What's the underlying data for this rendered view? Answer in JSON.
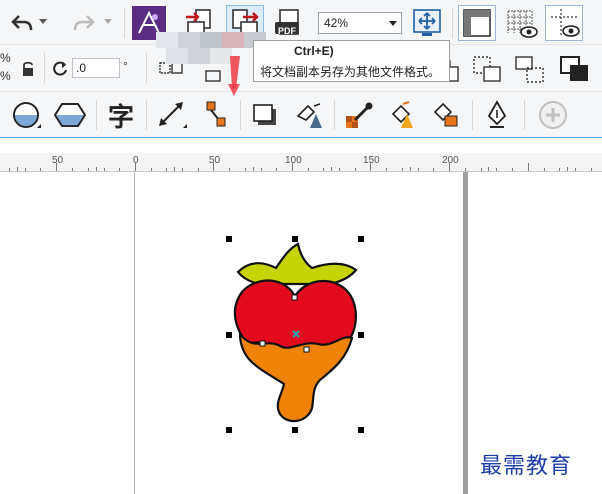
{
  "toolbar_top": {
    "zoom_value": "42%",
    "export_pdf_label": "PDF"
  },
  "toolbar_props": {
    "left_labels": [
      "%",
      "%"
    ],
    "angle_value": ".0",
    "angle_unit": "°"
  },
  "toolbox": {
    "text_tool_glyph": "字"
  },
  "tooltip": {
    "shortcut": "Ctrl+E)",
    "description": "将文档副本另存为其他文件格式。"
  },
  "ruler": {
    "labels": [
      "50",
      "0",
      "50",
      "100",
      "150",
      "200"
    ]
  },
  "watermark": {
    "text": "最需教育"
  },
  "colors": {
    "strawberry_red": "#e3091f",
    "chocolate_orange": "#ee8307",
    "leaf_green": "#c6d305",
    "accent_blue": "#4aa3df",
    "watermark_blue": "#1e3fa8"
  }
}
